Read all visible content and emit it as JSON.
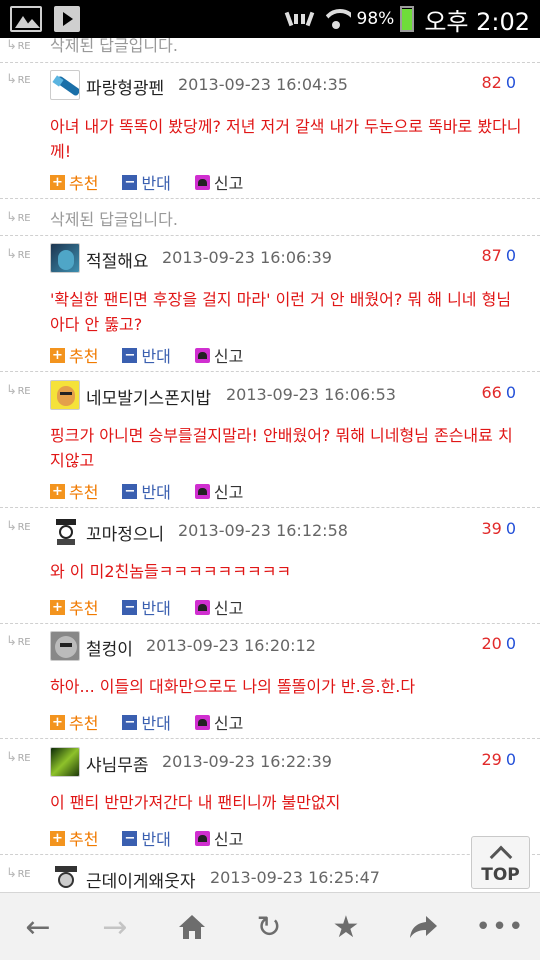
{
  "status_bar": {
    "battery": "98%",
    "time": "오후 2:02"
  },
  "comments": [
    {
      "re": "RE",
      "deleted": true,
      "text": "삭제된 답글입니다."
    },
    {
      "re": "RE",
      "nick": "파랑형광펜",
      "date": "2013-09-23 16:04:35",
      "up": "82",
      "down": "0",
      "body": "아녀 내가 똑똑이 봤당께? 저년 저거 갈색 내가 두눈으로 똑바로 봤다니께!",
      "actions": {
        "recommend": "추천",
        "oppose": "반대",
        "report": "신고"
      }
    },
    {
      "re": "RE",
      "deleted": true,
      "text": "삭제된 답글입니다."
    },
    {
      "re": "RE",
      "nick": "적절해요",
      "date": "2013-09-23 16:06:39",
      "up": "87",
      "down": "0",
      "body": "'확실한 팬티면 후장을 걸지 마라' 이런 거 안 배웠어? 뭐 해 니네 형님 아다 안 뚫고?",
      "actions": {
        "recommend": "추천",
        "oppose": "반대",
        "report": "신고"
      }
    },
    {
      "re": "RE",
      "nick": "네모발기스폰지밥",
      "date": "2013-09-23 16:06:53",
      "up": "66",
      "down": "0",
      "body": "핑크가 아니면 승부를걸지말라! 안배웠어? 뭐해 니네형님 존슨내료 치지않고",
      "actions": {
        "recommend": "추천",
        "oppose": "반대",
        "report": "신고"
      }
    },
    {
      "re": "RE",
      "nick": "꼬마정으니",
      "date": "2013-09-23 16:12:58",
      "up": "39",
      "down": "0",
      "body": "와 이 미2친놈들ㅋㅋㅋㅋㅋㅋㅋㅋㅋ",
      "actions": {
        "recommend": "추천",
        "oppose": "반대",
        "report": "신고"
      }
    },
    {
      "re": "RE",
      "nick": "철컹이",
      "date": "2013-09-23 16:20:12",
      "up": "20",
      "down": "0",
      "body": "하아... 이들의 대화만으로도 나의 똘똘이가 반.응.한.다",
      "actions": {
        "recommend": "추천",
        "oppose": "반대",
        "report": "신고"
      }
    },
    {
      "re": "RE",
      "nick": "샤님무좀",
      "date": "2013-09-23 16:22:39",
      "up": "29",
      "down": "0",
      "body": "이 팬티 반만가져간다 내 팬티니까 불만없지",
      "actions": {
        "recommend": "추천",
        "oppose": "반대",
        "report": "신고"
      }
    },
    {
      "re": "RE",
      "nick": "근데이게왜웃자",
      "date": "2013-09-23 16:25:47"
    }
  ],
  "top_button": "TOP",
  "toolbar": {
    "back": "back-icon",
    "forward": "forward-icon",
    "home": "home-icon",
    "reload": "reload-icon",
    "bookmark": "star-icon",
    "share": "share-icon",
    "more": "more-icon"
  }
}
